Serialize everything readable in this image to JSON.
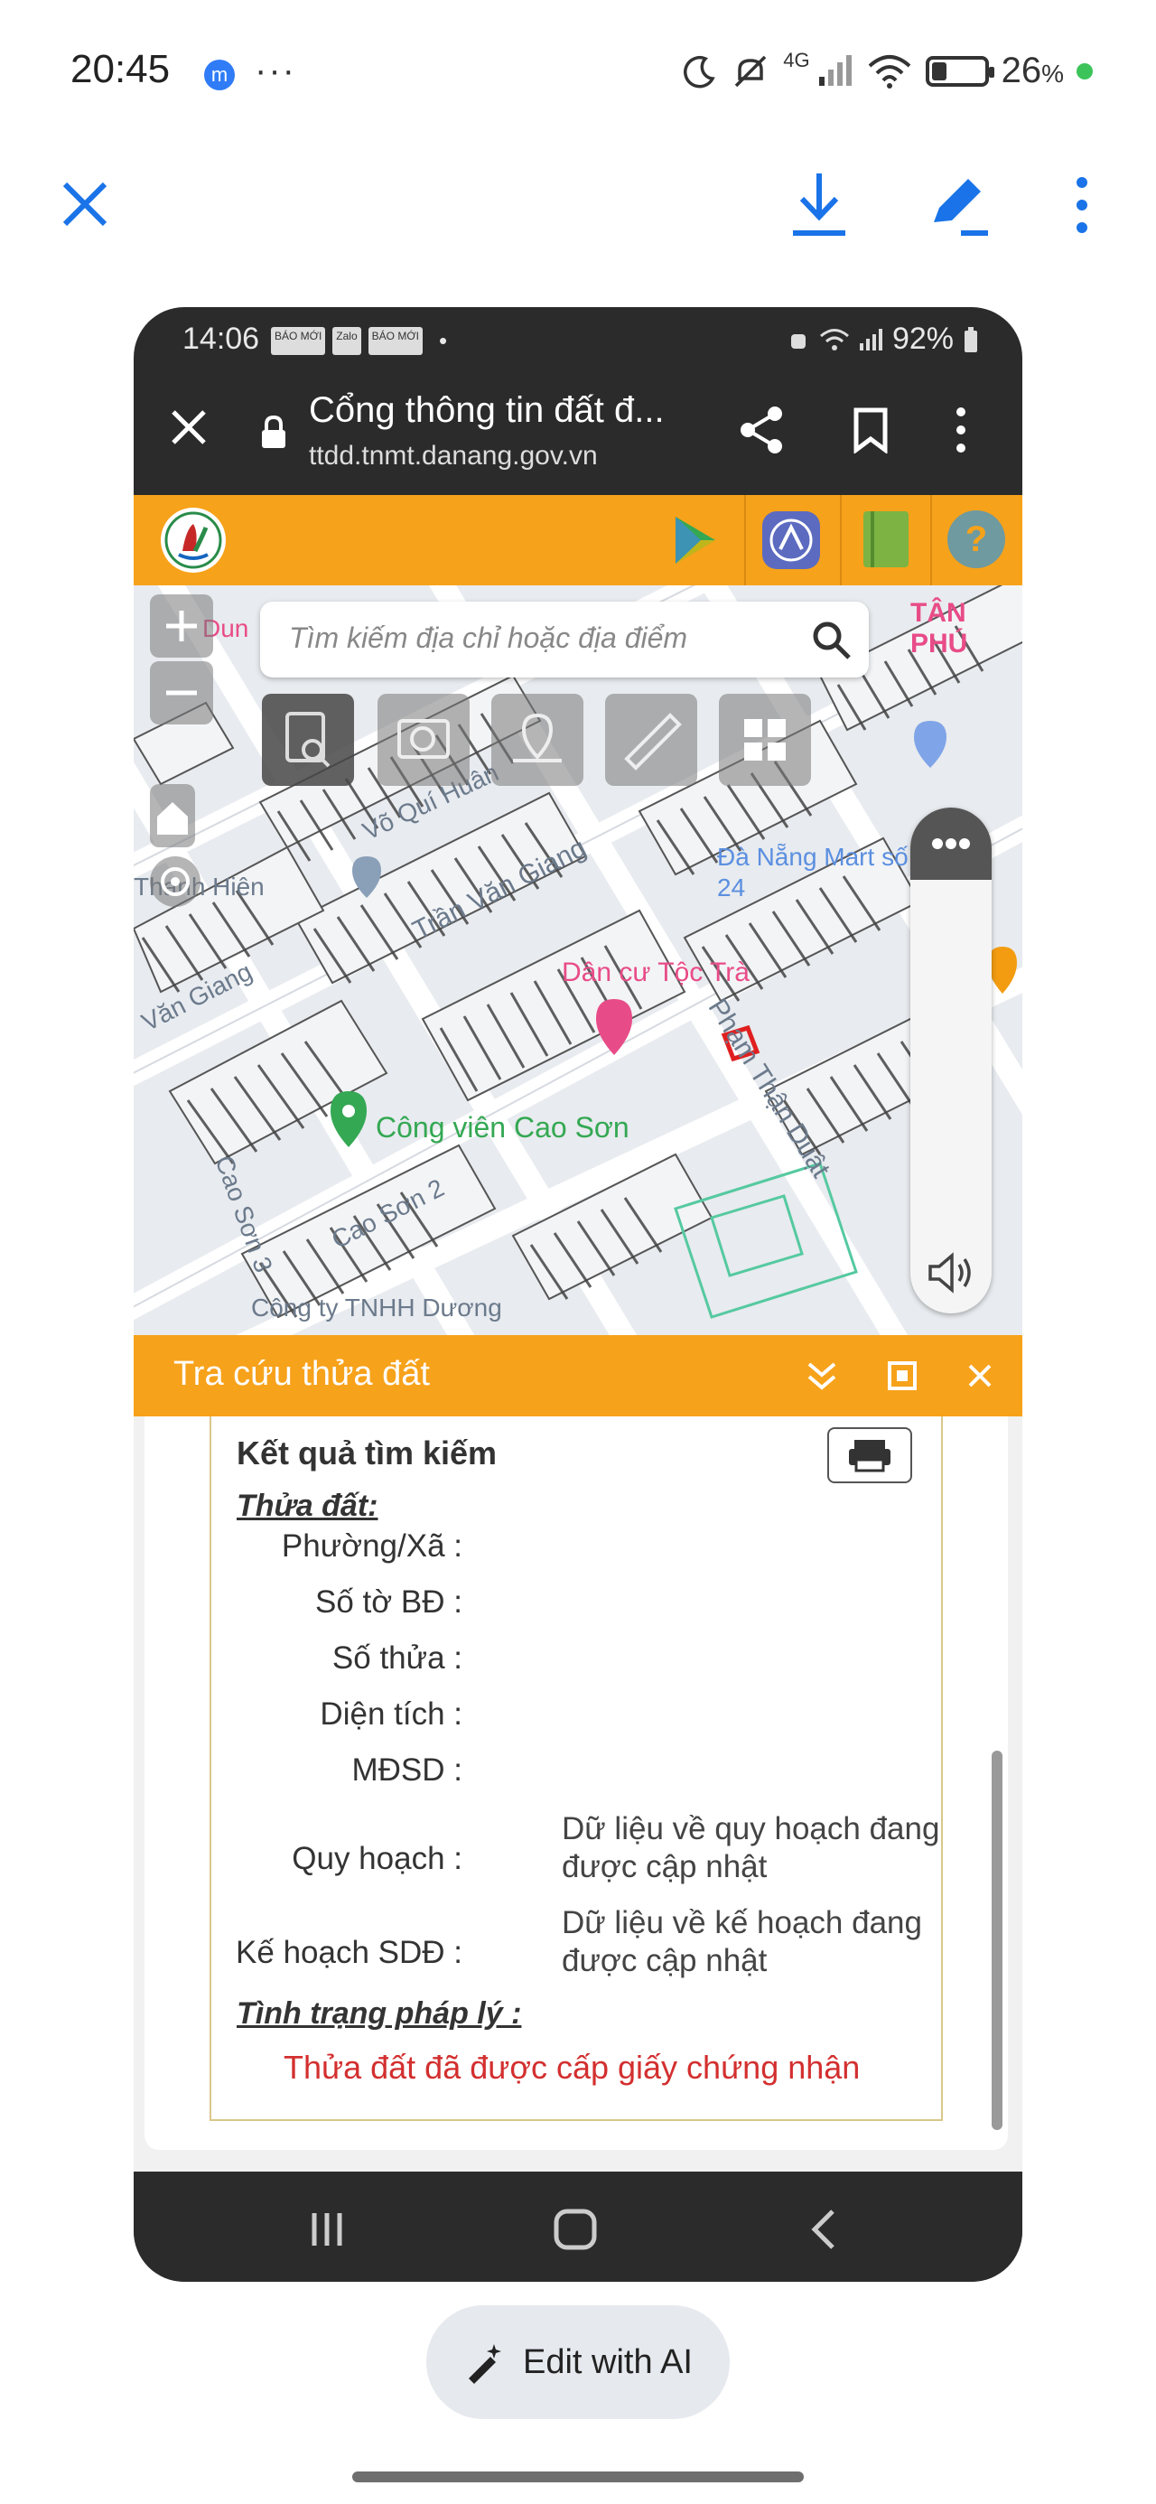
{
  "os_status": {
    "time": "20:45",
    "messenger_badge": "m",
    "more": "···",
    "network": "4G",
    "battery_percent": "26",
    "battery_unit": "%",
    "battery_level": 0.26
  },
  "viewer_toolbar": {
    "close_icon": "close-icon",
    "download_icon": "download-icon",
    "edit_icon": "pen-icon",
    "more_icon": "more-vert-icon"
  },
  "inner_status": {
    "time": "14:06",
    "app_badges": [
      "BÁO MỚI",
      "Zalo",
      "BÁO MỚI"
    ],
    "dot": "•",
    "battery": "92%"
  },
  "browser": {
    "title": "Cổng thông tin đất đ...",
    "url": "ttdd.tnmt.danang.gov.vn"
  },
  "search": {
    "placeholder": "Tìm kiếm địa chỉ hoặc địa điểm"
  },
  "map_labels": {
    "street1": "Võ Quí Huân",
    "street2": "Trần Văn Giang",
    "street3": "Văn Giang",
    "street4": "Thanh Hiên",
    "street5": "Phạm Thận Duật",
    "street6": "Cao Sơn 2",
    "street7": "Cao Sơn 3",
    "poi1": "Công viên Cao Sơn",
    "poi2": "Dân cư Tộc Trà",
    "poi3": "Đà Nẵng Mart số 24",
    "poi4": "Công ty TNHH Dương",
    "poi5": "TÂN PHÚ",
    "poi6": "Dun"
  },
  "panel": {
    "title": "Tra cứu thửa đất"
  },
  "result": {
    "heading": "Kết quả tìm kiếm",
    "section1": "Thửa đất:",
    "rows": [
      {
        "label": "Phường/Xã :",
        "value": ""
      },
      {
        "label": "Số tờ BĐ :",
        "value": ""
      },
      {
        "label": "Số thửa :",
        "value": ""
      },
      {
        "label": "Diện tích :",
        "value": ""
      },
      {
        "label": "MĐSD :",
        "value": ""
      },
      {
        "label": "Quy hoạch :",
        "value": "Dữ liệu về quy hoạch đang được cập nhật"
      },
      {
        "label": "Kế hoạch SDĐ :",
        "value": "Dữ liệu về kế hoạch đang được cập nhật"
      }
    ],
    "section2": "Tình trạng pháp lý :",
    "legal_status": "Thửa đất đã được cấp giấy chứng nhận"
  },
  "edit_ai": {
    "label": "Edit with AI"
  },
  "colors": {
    "accent_orange": "#f7a21b",
    "toolbar_blue": "#1a73e8",
    "legal_red": "#d32f2f",
    "dark_chrome": "#2b2b2b"
  }
}
